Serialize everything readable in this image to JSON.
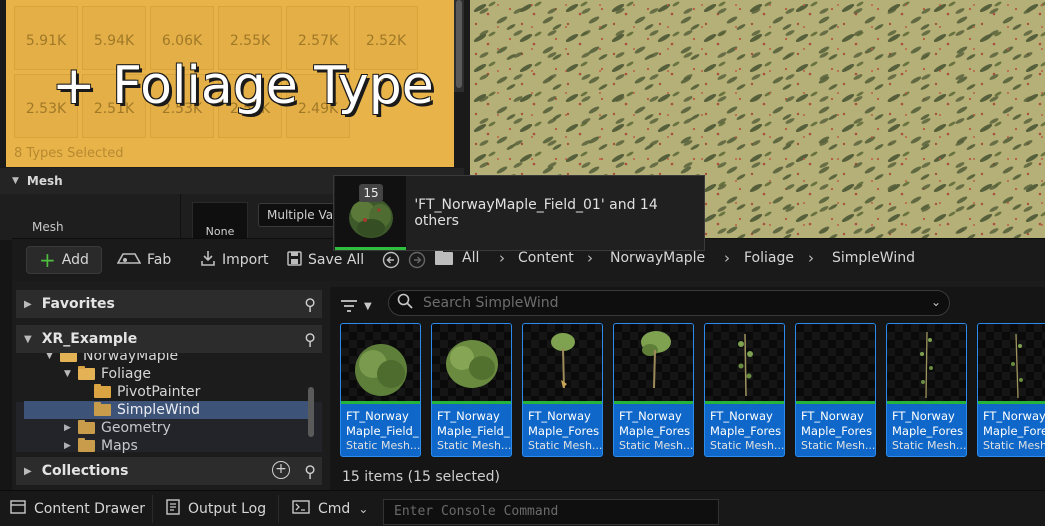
{
  "foliage": {
    "counts": [
      "5.91K",
      "5.94K",
      "6.06K",
      "2.55K",
      "2.57K",
      "2.52K",
      "2.53K",
      "2.51K",
      "2.53K",
      "2.54K",
      "2.49K"
    ],
    "overlay_text": "+ Foliage Type",
    "selection_text": "8 Types Selected",
    "accent": "#e8b44a"
  },
  "mesh": {
    "section": "Mesh",
    "label": "Mesh",
    "thumb_value": "None",
    "combo_value": "Multiple Values"
  },
  "drag": {
    "badge": "15",
    "text": "'FT_NorwayMaple_Field_01' and 14 others"
  },
  "toolbar": {
    "add": "Add",
    "fab": "Fab",
    "import": "Import",
    "save_all": "Save All"
  },
  "breadcrumb": [
    "All",
    "Content",
    "NorwayMaple",
    "Foliage",
    "SimpleWind"
  ],
  "tree": {
    "favorites": "Favorites",
    "project": "XR_Example",
    "collections": "Collections",
    "items": [
      {
        "label": "NorwayMaple",
        "state": "expanded"
      },
      {
        "label": "Foliage",
        "state": "expanded"
      },
      {
        "label": "PivotPainter",
        "state": "leaf"
      },
      {
        "label": "SimpleWind",
        "state": "selected"
      },
      {
        "label": "Geometry",
        "state": "collapsed"
      },
      {
        "label": "Maps",
        "state": "collapsed"
      }
    ]
  },
  "search": {
    "placeholder": "Search SimpleWind"
  },
  "assets": [
    {
      "name": "FT_Norway Maple_Field_",
      "type": "Static Mesh..."
    },
    {
      "name": "FT_Norway Maple_Field_",
      "type": "Static Mesh..."
    },
    {
      "name": "FT_Norway Maple_Forest_",
      "type": "Static Mesh..."
    },
    {
      "name": "FT_Norway Maple_Forest_",
      "type": "Static Mesh..."
    },
    {
      "name": "FT_Norway Maple_Forest_",
      "type": "Static Mesh..."
    },
    {
      "name": "FT_Norway Maple_Forest_",
      "type": "Static Mesh..."
    },
    {
      "name": "FT_Norway Maple_Forest_",
      "type": "Static Mesh..."
    },
    {
      "name": "FT_Norway Maple_Forest_",
      "type": "Static Mesh..."
    }
  ],
  "status": {
    "items_count": "15 items (15 selected)"
  },
  "bottom": {
    "content_drawer": "Content Drawer",
    "output_log": "Output Log",
    "cmd": "Cmd",
    "console_placeholder": "Enter Console Command"
  },
  "colors": {
    "selection_blue": "#0f68c9",
    "asset_bar_green": "#26b33a",
    "folder_gold": "#d9a441"
  }
}
